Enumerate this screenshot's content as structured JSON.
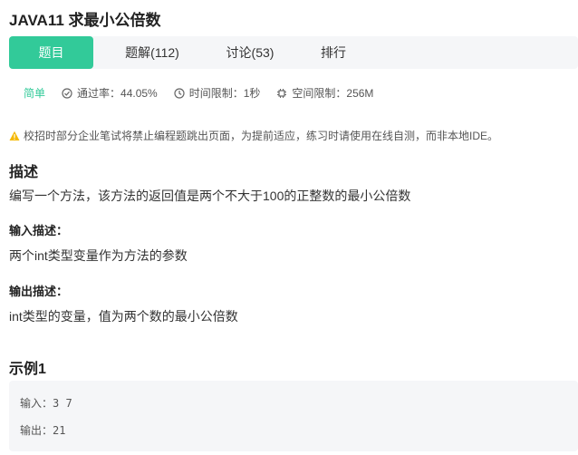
{
  "title": "JAVA11  求最小公倍数",
  "tabs": [
    {
      "label": "题目"
    },
    {
      "label": "题解(112)"
    },
    {
      "label": "讨论(53)"
    },
    {
      "label": "排行"
    }
  ],
  "meta": {
    "difficulty": "简单",
    "pass_rate": "通过率：44.05%",
    "time_limit": "时间限制：1秒",
    "space_limit": "空间限制：256M"
  },
  "notice": "校招时部分企业笔试将禁止编程题跳出页面，为提前适应，练习时请使用在线自测，而非本地IDE。",
  "description": {
    "heading": "描述",
    "text": "编写一个方法，该方法的返回值是两个不大于100的正整数的最小公倍数"
  },
  "input_desc": {
    "heading": "输入描述：",
    "text": "两个int类型变量作为方法的参数"
  },
  "output_desc": {
    "heading": "输出描述：",
    "text": "int类型的变量，值为两个数的最小公倍数"
  },
  "example": {
    "heading": "示例1",
    "input": "输入：3 7",
    "output": "输出：21"
  },
  "colors": {
    "accent": "#32ca99",
    "tabbar_bg": "#f5f6f8",
    "warning": "#f5b800"
  }
}
